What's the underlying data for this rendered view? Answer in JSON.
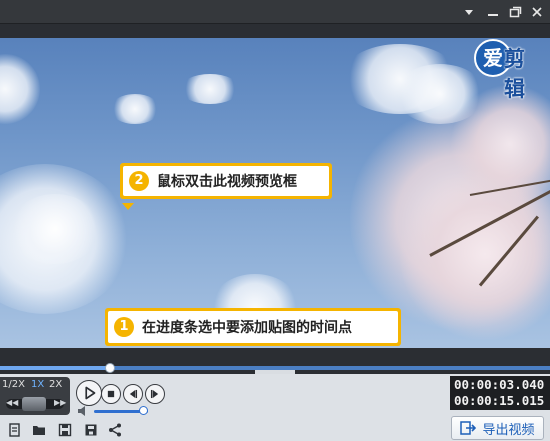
{
  "window": {
    "menu_icon": "dropdown-triangle-icon",
    "min_icon": "minimize-icon",
    "restore_icon": "restore-icon",
    "close_icon": "close-icon"
  },
  "logo": {
    "circle_text": "爱",
    "text": "剪辑"
  },
  "callouts": [
    {
      "number": "2",
      "text": "鼠标双击此视频预览框"
    },
    {
      "number": "1",
      "text": "在进度条选中要添加贴图的时间点"
    }
  ],
  "progress": {
    "fraction": 0.2,
    "collapse_icon": "chevron-down-icon"
  },
  "speed": {
    "options": [
      "1/2X",
      "1X",
      "2X"
    ],
    "selected": "1X",
    "left_icon": "rewind-icon",
    "right_icon": "fast-forward-icon"
  },
  "playback": {
    "play_icon": "play-icon",
    "stop_icon": "stop-icon",
    "prev_frame_icon": "previous-frame-icon",
    "next_frame_icon": "next-frame-icon"
  },
  "volume": {
    "level": 0.9,
    "icon": "speaker-icon"
  },
  "timecode": {
    "current": "00:00:03.040",
    "total": "00:00:15.015"
  },
  "toolbar": {
    "icons": [
      "new-project-icon",
      "open-folder-icon",
      "save-icon",
      "save-as-icon",
      "share-icon"
    ],
    "export_label": "导出视频",
    "export_icon": "export-icon"
  },
  "colors": {
    "accent": "#f5b400",
    "progress": "#4b7fc4",
    "export_text": "#1d5fb8"
  }
}
